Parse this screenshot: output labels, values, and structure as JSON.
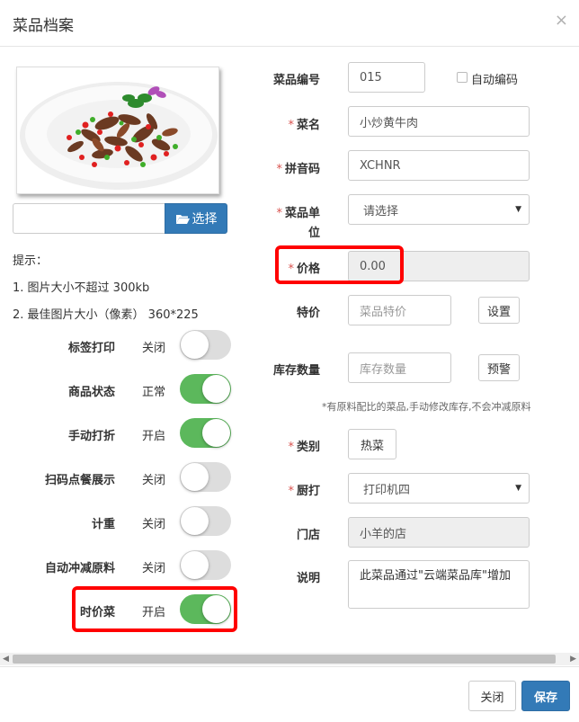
{
  "modal": {
    "title": "菜品档案",
    "close_icon": "×"
  },
  "image_panel": {
    "choose_label": "选择",
    "folder_icon": "folder-open-icon"
  },
  "tips": {
    "heading": "提示：",
    "line1": "1. 图片大小不超过 300kb",
    "line2": "2. 最佳图片大小（像素） 360*225"
  },
  "toggles": [
    {
      "label": "标签打印",
      "state": "关闭",
      "on": false
    },
    {
      "label": "商品状态",
      "state": "正常",
      "on": true
    },
    {
      "label": "手动打折",
      "state": "开启",
      "on": true
    },
    {
      "label": "扫码点餐展示",
      "state": "关闭",
      "on": false
    },
    {
      "label": "计重",
      "state": "关闭",
      "on": false
    },
    {
      "label": "自动冲减原料",
      "state": "关闭",
      "on": false
    },
    {
      "label": "时价菜",
      "state": "开启",
      "on": true
    }
  ],
  "form": {
    "code": {
      "label": "菜品编号",
      "value": "015"
    },
    "auto_code": {
      "label": "自动编码",
      "checked": false
    },
    "name": {
      "label": "菜名",
      "value": "小炒黄牛肉"
    },
    "pinyin": {
      "label": "拼音码",
      "value": "XCHNR"
    },
    "unit": {
      "label_1": "菜品单",
      "label_2": "位",
      "value": "请选择"
    },
    "price": {
      "label": "价格",
      "value": "0.00"
    },
    "special": {
      "label": "特价",
      "placeholder": "菜品特价",
      "button": "设置"
    },
    "stock": {
      "label": "库存数量",
      "placeholder": "库存数量",
      "button": "预警"
    },
    "note": "*有原料配比的菜品,手动修改库存,不会冲减原料",
    "category": {
      "label": "类别",
      "value": "热菜"
    },
    "kitchen_print": {
      "label": "厨打",
      "value": "打印机四"
    },
    "store": {
      "label": "门店",
      "value": "小羊的店"
    },
    "description": {
      "label": "说明",
      "value": "此菜品通过\"云端菜品库\"增加"
    }
  },
  "required_mark": "*",
  "footer": {
    "close_label": "关闭",
    "save_label": "保存"
  },
  "colors": {
    "primary": "#337ab7",
    "toggle_on": "#5cb85c",
    "required": "#d9534f",
    "highlight": "#ff0000"
  }
}
